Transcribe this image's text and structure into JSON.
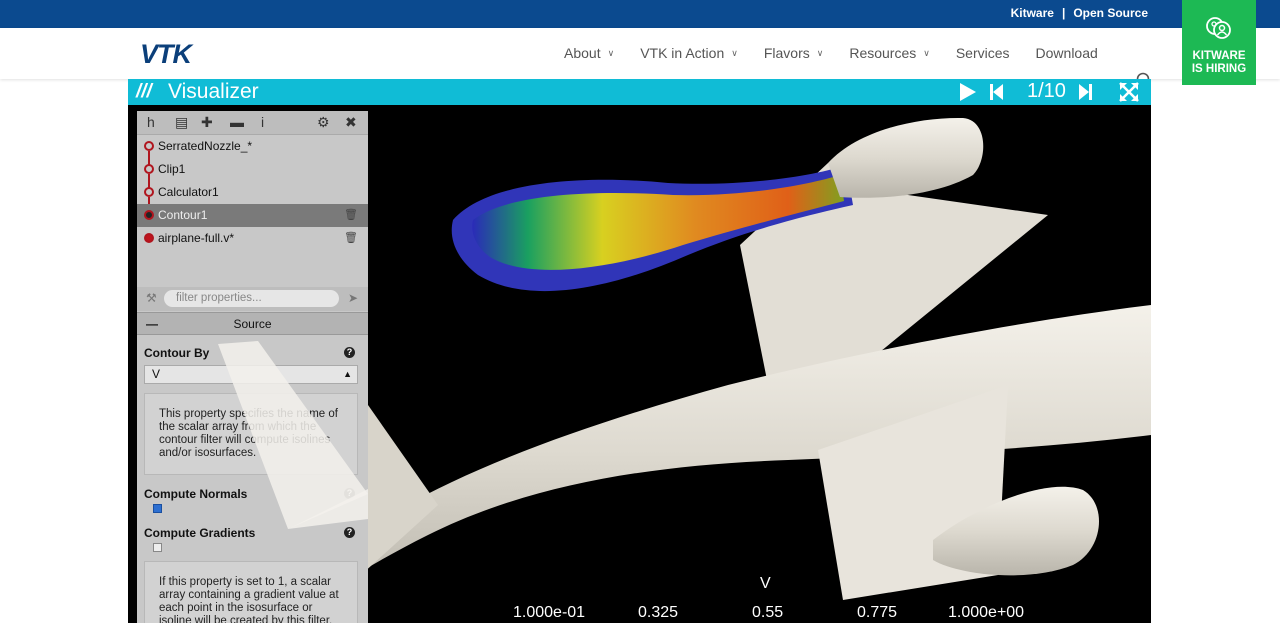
{
  "topbar": {
    "brand": "Kitware",
    "separator": "|",
    "link": "Open Source"
  },
  "nav": {
    "logo": "VTK",
    "items": [
      {
        "label": "About",
        "dropdown": true
      },
      {
        "label": "VTK in Action",
        "dropdown": true
      },
      {
        "label": "Flavors",
        "dropdown": true
      },
      {
        "label": "Resources",
        "dropdown": true
      },
      {
        "label": "Services",
        "dropdown": false
      },
      {
        "label": "Download",
        "dropdown": false
      }
    ],
    "search_icon": "search-icon"
  },
  "hiring": {
    "line1": "KITWARE",
    "line2": "IS HIRING"
  },
  "video": {
    "title": "Visualizer",
    "frame": "1/10",
    "controls": [
      "play-icon",
      "step-back-icon",
      "step-forward-icon",
      "fullscreen-icon"
    ]
  },
  "panel": {
    "toolbar_icons": [
      "pipeline-icon",
      "file-icon",
      "add-icon",
      "save-icon",
      "info-icon",
      "settings-icon",
      "collapse-icon"
    ],
    "pipeline": [
      {
        "label": "SerratedNozzle_*",
        "selected": false
      },
      {
        "label": "Clip1",
        "selected": false
      },
      {
        "label": "Calculator1",
        "selected": false
      },
      {
        "label": "Contour1",
        "selected": true
      },
      {
        "label": "airplane-full.v*",
        "selected": false
      }
    ],
    "filter_placeholder": "filter properties...",
    "section_title": "Source",
    "contour_by_label": "Contour By",
    "contour_by_value": "V",
    "contour_by_help": "This property specifies the name of the scalar array from which the contour filter will compute isolines and/or isosurfaces.",
    "compute_normals_label": "Compute Normals",
    "compute_normals_checked": true,
    "compute_gradients_label": "Compute Gradients",
    "compute_gradients_checked": false,
    "gradients_help": "If this property is set to 1, a scalar array containing a gradient value at each point in the isosurface or isoline will be created by this filter."
  },
  "colorbar": {
    "title": "V",
    "ticks": [
      "1.000e-01",
      "0.325",
      "0.55",
      "0.775",
      "1.000e+00"
    ]
  },
  "colors": {
    "topbar": "#0b4a8f",
    "hiring": "#1db954",
    "titlebar": "#10bcd6",
    "pipeline_red": "#b0151e"
  }
}
